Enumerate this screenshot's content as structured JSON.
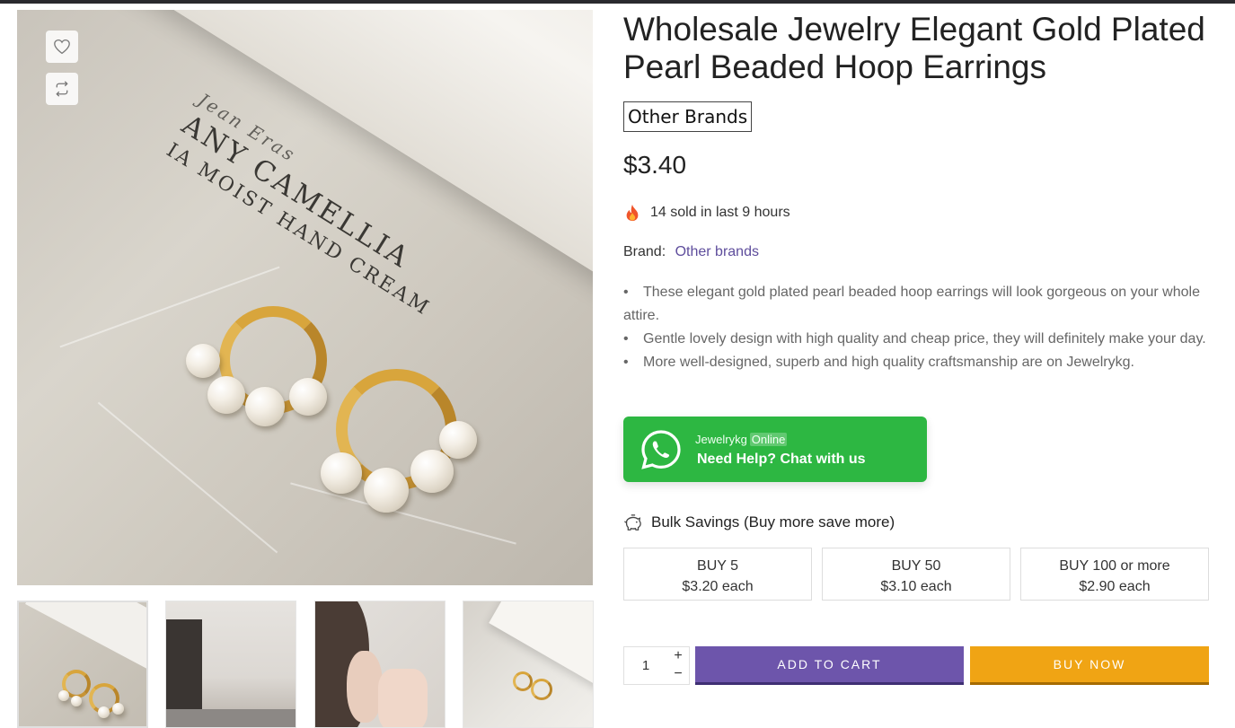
{
  "product": {
    "title": "Wholesale Jewelry Elegant Gold Plated Pearl Beaded Hoop Earrings",
    "brand_badge": "Other Brands",
    "price": "$3.40",
    "sold_text": "14 sold in last 9 hours",
    "brand_label": "Brand:",
    "brand_link": "Other brands",
    "description": [
      "These elegant gold plated pearl beaded hoop earrings will look gorgeous on your whole attire.",
      "Gentle lovely design with high quality and cheap price, they will definitely make your day.",
      "More well-designed, superb and high quality craftsmanship are on Jewelrykg."
    ]
  },
  "image": {
    "tube_text": [
      "Jean Eras",
      "ANY CAMELLIA",
      "IA MOIST HAND CREAM"
    ]
  },
  "whatsapp": {
    "name": "Jewelrykg",
    "status": "Online",
    "cta": "Need Help? Chat with us"
  },
  "bulk": {
    "title": "Bulk Savings (Buy more save more)",
    "tiers": [
      {
        "qty": "BUY 5",
        "price": "$3.20 each"
      },
      {
        "qty": "BUY 50",
        "price": "$3.10 each"
      },
      {
        "qty": "BUY 100 or more",
        "price": "$2.90 each"
      }
    ]
  },
  "cart": {
    "quantity": "1",
    "plus": "+",
    "minus": "−",
    "add_to_cart": "ADD TO CART",
    "buy_now": "BUY NOW"
  },
  "colors": {
    "accent_purple": "#6d55ab",
    "buy_now_orange": "#f0a414",
    "whatsapp_green": "#2db742",
    "brand_link": "#5e4d9c"
  },
  "icons": [
    "heart-icon",
    "compare-icon",
    "fire-icon",
    "whatsapp-icon",
    "piggy-bank-icon"
  ]
}
